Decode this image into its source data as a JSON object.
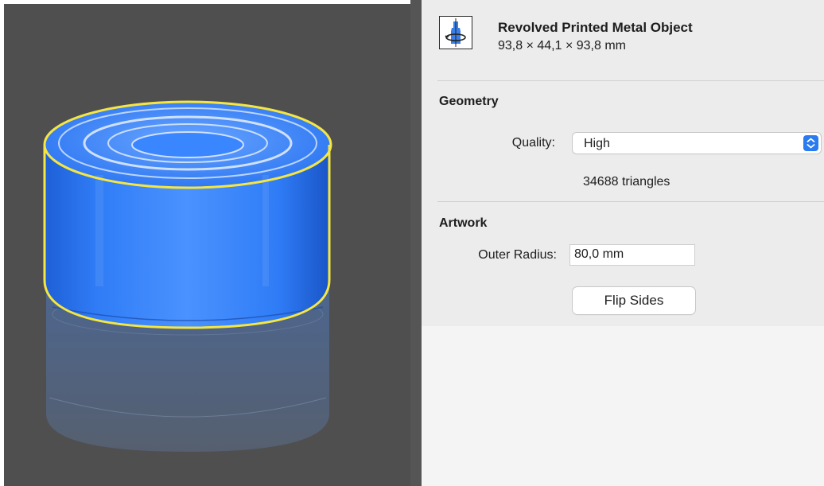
{
  "viewport": {
    "object_icon_name": "revolved-can-3d-render",
    "selection_color": "#f5e642",
    "object_color": "#2f7cf6",
    "background_color": "#4f4f4f"
  },
  "inspector": {
    "object_type_icon": "revolve-bottle-icon",
    "object_title": "Revolved Printed Metal Object",
    "object_dimensions": "93,8 × 44,1 × 93,8 mm",
    "geometry": {
      "heading": "Geometry",
      "quality_label": "Quality:",
      "quality_value": "High",
      "triangle_count": "34688 triangles"
    },
    "artwork": {
      "heading": "Artwork",
      "outer_radius_label": "Outer Radius:",
      "outer_radius_value": "80,0 mm",
      "flip_sides_label": "Flip Sides"
    },
    "accent_color": "#2b7bf0"
  }
}
